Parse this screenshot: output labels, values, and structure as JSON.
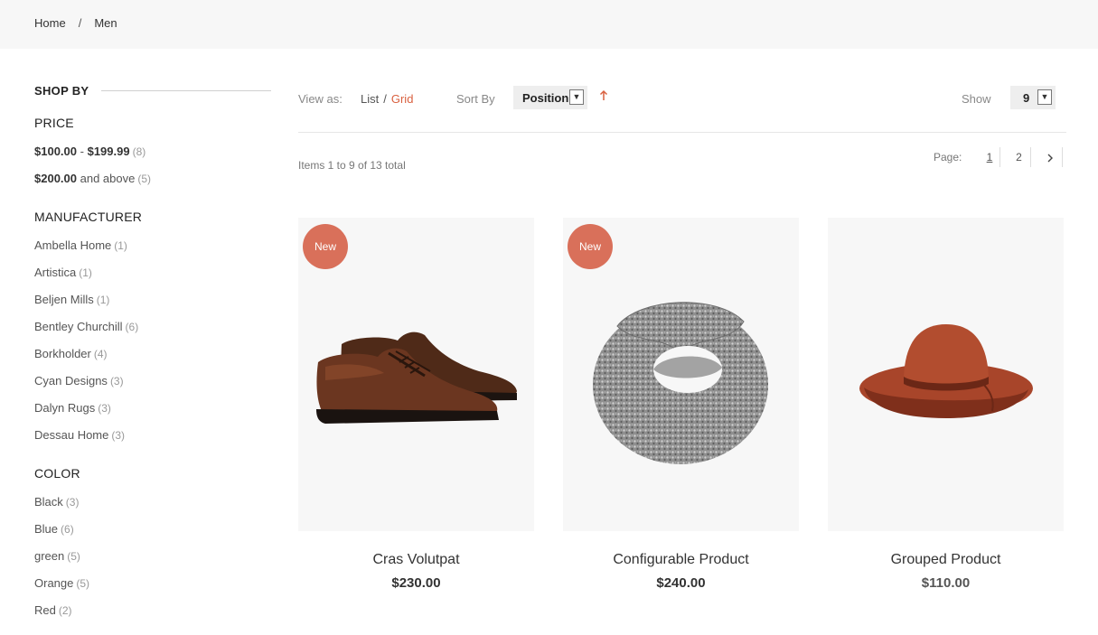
{
  "breadcrumb": {
    "home": "Home",
    "separator": "/",
    "current": "Men"
  },
  "sidebar": {
    "title": "SHOP BY",
    "price": {
      "title": "PRICE",
      "items": [
        {
          "from": "$100.00",
          "dash": "-",
          "to": "$199.99",
          "count": "(8)"
        },
        {
          "from": "$200.00",
          "suffix": "and above",
          "count": "(5)"
        }
      ]
    },
    "manufacturer": {
      "title": "MANUFACTURER",
      "items": [
        {
          "label": "Ambella Home",
          "count": "(1)"
        },
        {
          "label": "Artistica",
          "count": "(1)"
        },
        {
          "label": "Beljen Mills",
          "count": "(1)"
        },
        {
          "label": "Bentley Churchill",
          "count": "(6)"
        },
        {
          "label": "Borkholder",
          "count": "(4)"
        },
        {
          "label": "Cyan Designs",
          "count": "(3)"
        },
        {
          "label": "Dalyn Rugs",
          "count": "(3)"
        },
        {
          "label": "Dessau Home",
          "count": "(3)"
        }
      ]
    },
    "color": {
      "title": "COLOR",
      "items": [
        {
          "label": "Black",
          "count": "(3)"
        },
        {
          "label": "Blue",
          "count": "(6)"
        },
        {
          "label": "green",
          "count": "(5)"
        },
        {
          "label": "Orange",
          "count": "(5)"
        },
        {
          "label": "Red",
          "count": "(2)"
        }
      ]
    }
  },
  "toolbar": {
    "view_as_label": "View as:",
    "view_list": "List",
    "view_separator": "/",
    "view_grid": "Grid",
    "sort_by_label": "Sort By",
    "sort_value": "Position",
    "sort_direction_icon": "arrow-up-icon",
    "show_label": "Show",
    "show_value": "9",
    "items_total": "Items 1 to 9 of 13 total",
    "pager_label": "Page:",
    "pages": [
      "1",
      "2"
    ],
    "next_icon": "chevron-right-icon",
    "accent_color": "#d9603f"
  },
  "products": [
    {
      "name": "Cras Volutpat",
      "price": "$230.00",
      "badge": "New",
      "image_icon": "oxford-shoes"
    },
    {
      "name": "Configurable Product",
      "price": "$240.00",
      "badge": "New",
      "image_icon": "knit-scarf"
    },
    {
      "name": "Grouped Product",
      "price": "$110.00",
      "badge": "",
      "image_icon": "felt-hat"
    }
  ]
}
